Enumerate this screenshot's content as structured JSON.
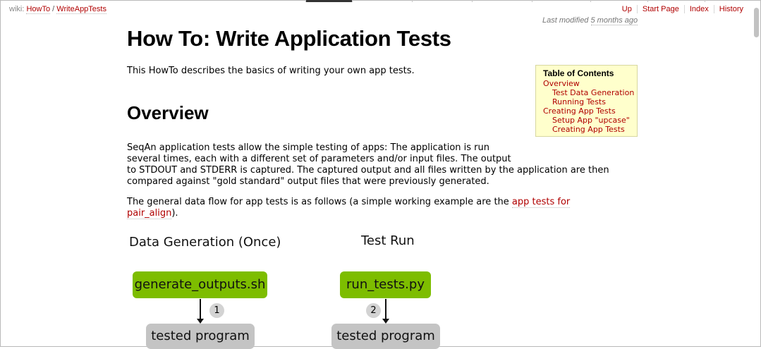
{
  "breadcrumb": {
    "label": "wiki:",
    "items": [
      "HowTo",
      "WriteAppTests"
    ],
    "separator": "/"
  },
  "metanav": {
    "items": [
      "Up",
      "Start Page",
      "Index",
      "History"
    ]
  },
  "last_modified": {
    "prefix": "Last modified",
    "ago": "5 months ago"
  },
  "page": {
    "title": "How To: Write Application Tests",
    "intro": "This HowTo describes the basics of writing your own app tests.",
    "overview_heading": "Overview",
    "paragraph1_lines": [
      "SeqAn application tests allow the simple testing of apps: The application is run",
      "several times, each with a different set of parameters and/or input files. The output",
      "to STDOUT and STDERR is captured. The captured output and all files written by the application are then",
      "compared against \"gold standard\" output files that were previously generated."
    ],
    "paragraph2_before": "The general data flow for app tests is as follows (a simple working example are the ",
    "paragraph2_link_a": "app tests for",
    "paragraph2_link_b": "pair_align",
    "paragraph2_after": ")."
  },
  "toc": {
    "title": "Table of Contents",
    "items": [
      "Overview",
      "Test Data Generation",
      "Running Tests",
      "Creating App Tests",
      "Setup App \"upcase\"",
      "Creating App Tests"
    ]
  },
  "diagram": {
    "left_title": "Data Generation (Once)",
    "right_title": "Test Run",
    "left_script": "generate_outputs.sh",
    "right_script": "run_tests.py",
    "left_step": "1",
    "right_step": "2",
    "left_program": "tested program",
    "right_program": "tested program"
  },
  "colors": {
    "link": "#b00000",
    "toc_bg": "#ffffcc",
    "script_box": "#7dbd00",
    "program_box": "#c4c4c4"
  }
}
